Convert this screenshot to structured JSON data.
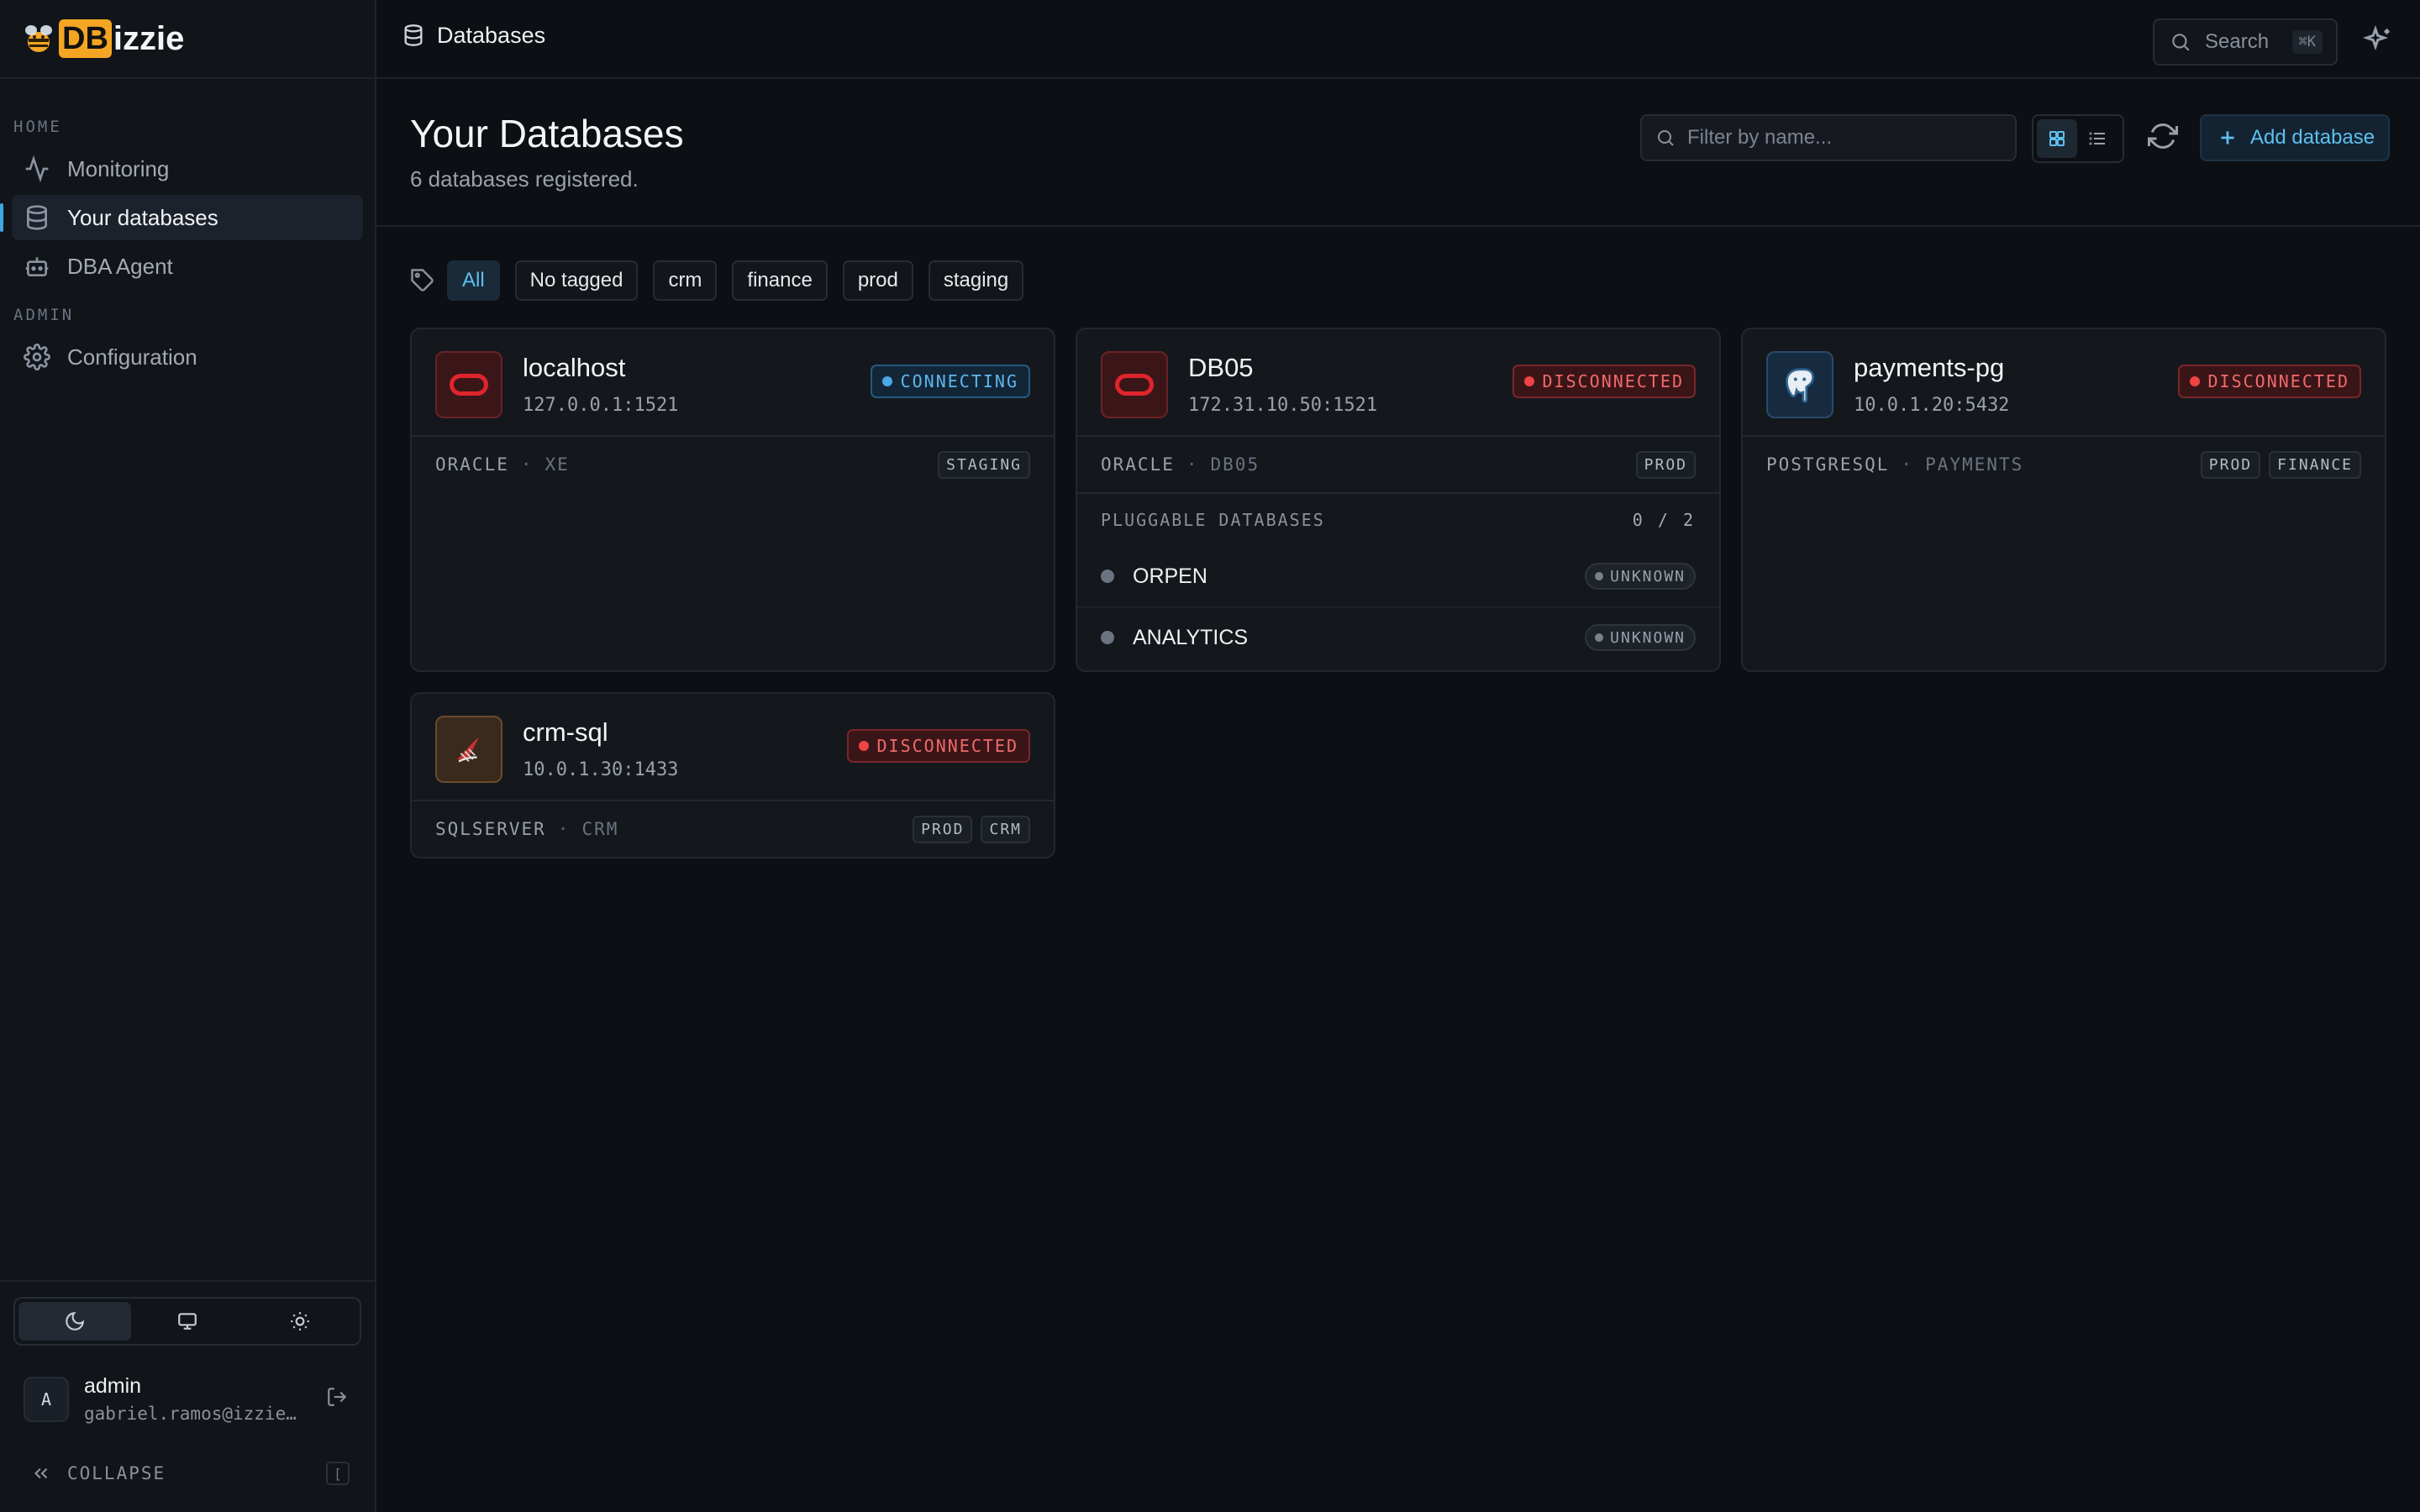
{
  "app": {
    "logo_db": "DB",
    "logo_rest": "izzie"
  },
  "sidebar": {
    "sections": [
      {
        "label": "HOME"
      },
      {
        "label": "ADMIN"
      }
    ],
    "items": [
      {
        "label": "Monitoring",
        "icon": "activity-icon"
      },
      {
        "label": "Your databases",
        "icon": "database-icon",
        "active": true
      },
      {
        "label": "DBA Agent",
        "icon": "bot-icon"
      },
      {
        "label": "Configuration",
        "icon": "gear-icon"
      }
    ],
    "theme": {
      "active": "dark",
      "options": [
        "moon-icon",
        "monitor-icon",
        "sun-icon"
      ]
    },
    "user": {
      "initial": "A",
      "name": "admin",
      "email": "gabriel.ramos@izzie.dev"
    },
    "collapse_label": "COLLAPSE",
    "collapse_key": "["
  },
  "topbar": {
    "breadcrumb": "Databases",
    "search_label": "Search",
    "search_shortcut": "⌘K"
  },
  "header": {
    "title": "Your Databases",
    "subtitle": "6 databases registered.",
    "filter_placeholder": "Filter by name...",
    "add_label": "Add database"
  },
  "tags": [
    "All",
    "No tagged",
    "crm",
    "finance",
    "prod",
    "staging"
  ],
  "databases": [
    {
      "name": "localhost",
      "host": "127.0.0.1:1521",
      "status": "CONNECTING",
      "engine": "ORACLE",
      "service": "XE",
      "tags": [
        "STAGING"
      ]
    },
    {
      "name": "DB05",
      "host": "172.31.10.50:1521",
      "status": "DISCONNECTED",
      "engine": "ORACLE",
      "service": "DB05",
      "tags": [
        "PROD"
      ],
      "pdb_label": "PLUGGABLE DATABASES",
      "pdb_count": "0 / 2",
      "pdbs": [
        {
          "name": "ORPEN",
          "status": "UNKNOWN"
        },
        {
          "name": "ANALYTICS",
          "status": "UNKNOWN"
        }
      ]
    },
    {
      "name": "payments-pg",
      "host": "10.0.1.20:5432",
      "status": "DISCONNECTED",
      "engine": "POSTGRESQL",
      "service": "PAYMENTS",
      "tags": [
        "PROD",
        "FINANCE"
      ]
    },
    {
      "name": "crm-sql",
      "host": "10.0.1.30:1433",
      "status": "DISCONNECTED",
      "engine": "SQLSERVER",
      "service": "CRM",
      "tags": [
        "PROD",
        "CRM"
      ]
    }
  ],
  "colors": {
    "accent": "#5cc0f0",
    "disconnected": "#ef4444",
    "connecting": "#4aa8e8",
    "oracle": "#e0242c",
    "logo": "#f5a524"
  }
}
